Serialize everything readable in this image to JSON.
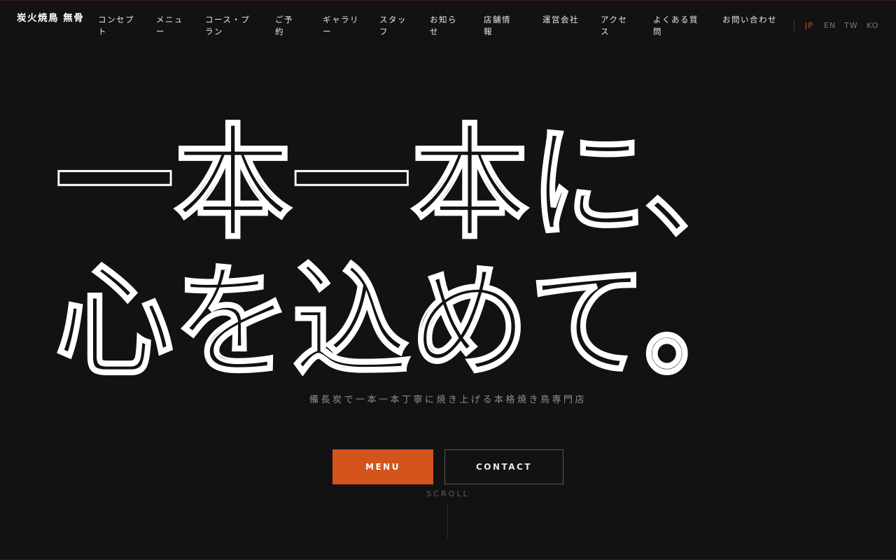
{
  "header": {
    "logo": "炭火焼鳥 無骨",
    "nav": [
      {
        "label": "コンセプト"
      },
      {
        "label": "メニュー"
      },
      {
        "label": "コース・プラン"
      },
      {
        "label": "ご予約"
      },
      {
        "label": "ギャラリー"
      },
      {
        "label": "スタッフ"
      },
      {
        "label": "お知らせ"
      },
      {
        "label": "店舗情報"
      },
      {
        "label": "運営会社"
      },
      {
        "label": "アクセス"
      },
      {
        "label": "よくある質問"
      },
      {
        "label": "お問い合わせ"
      }
    ],
    "languages": [
      {
        "label": "JP",
        "active": true
      },
      {
        "label": "EN",
        "active": false
      },
      {
        "label": "TW",
        "active": false
      },
      {
        "label": "KO",
        "active": false
      }
    ]
  },
  "hero": {
    "title_line1": "一本一本に、",
    "title_line2": "心を込めて。",
    "tagline": "備長炭で一本一本丁寧に焼き上げる本格焼き鳥専門店",
    "menu_button": "MENU",
    "contact_button": "CONTACT",
    "scroll_label": "SCROLL"
  },
  "colors": {
    "background": "#121212",
    "accent": "#d2541b",
    "outline_text": "#ffffff"
  }
}
